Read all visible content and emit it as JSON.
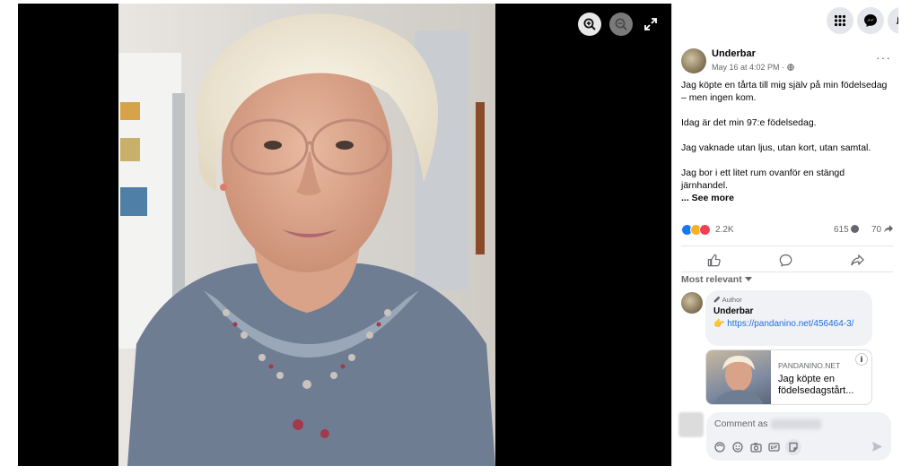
{
  "viewer": {
    "zoom_in_icon": "zoom-in-icon",
    "zoom_out_icon": "zoom-out-icon",
    "fullscreen_icon": "expand-icon"
  },
  "topbar": {
    "icons": [
      "grid-menu-icon",
      "messenger-icon",
      "notifications-icon"
    ]
  },
  "post": {
    "author": "Underbar",
    "time": "May 16 at 4:02 PM · ",
    "more": "···",
    "paragraphs": [
      "Jag köpte en tårta till mig själv på min födelsedag – men ingen kom.",
      "Idag är det min 97:e födelsedag.",
      "Jag vaknade utan ljus, utan kort, utan samtal.",
      "Jag bor i ett litet rum ovanför en stängd järnhandel."
    ],
    "see_more": "... See more",
    "reactions_count": "2.2K",
    "comments_count": "615",
    "shares_count": "70",
    "colors": {
      "like": "#1877f2",
      "haha": "#f7b125",
      "love": "#f33e58"
    }
  },
  "comments": {
    "filter_label": "Most relevant",
    "items": [
      {
        "badge": "Author",
        "name": "Underbar",
        "pointer": "👉",
        "link": "https://pandanino.net/456464-3/"
      }
    ],
    "card": {
      "site": "PANDANINO.NET",
      "title": "Jag köpte en födelsedagstårt..."
    }
  },
  "composer": {
    "placeholder": "Comment as",
    "icons": [
      "avatar-sticker-icon",
      "emoji-icon",
      "camera-icon",
      "gif-icon",
      "sticker-icon"
    ]
  }
}
